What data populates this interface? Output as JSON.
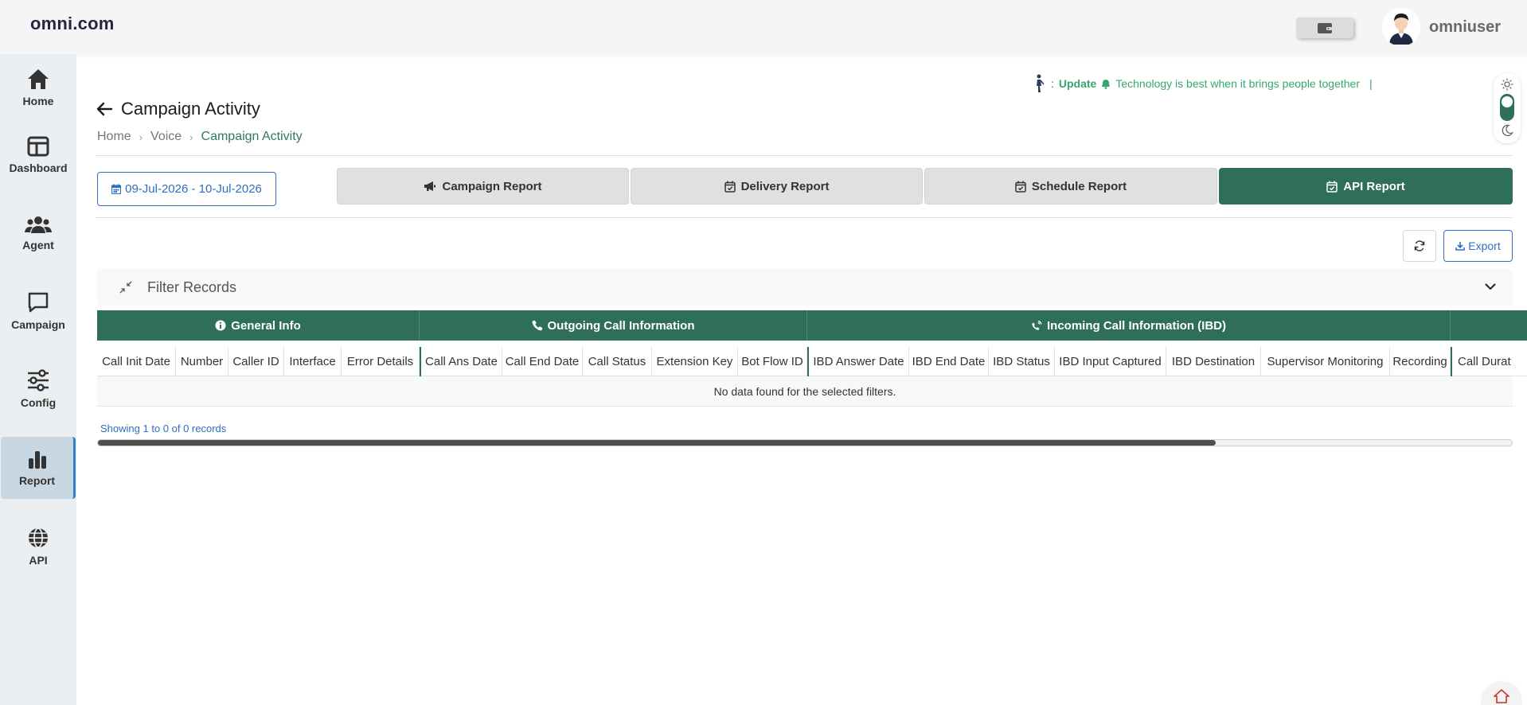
{
  "header": {
    "logo": "omni.com",
    "username": "omniuser"
  },
  "sidebar": {
    "items": [
      {
        "label": "Home",
        "icon": "home-icon"
      },
      {
        "label": "Dashboard",
        "icon": "dashboard-icon"
      },
      {
        "label": "Agent",
        "icon": "agent-icon"
      },
      {
        "label": "Campaign",
        "icon": "campaign-icon"
      },
      {
        "label": "Config",
        "icon": "config-icon"
      },
      {
        "label": "Report",
        "icon": "report-icon",
        "active": true
      },
      {
        "label": "API",
        "icon": "globe-icon"
      }
    ]
  },
  "ticker": {
    "prefix": ":",
    "label": "Update",
    "message": "Technology is best when it brings people together",
    "caret": "|"
  },
  "page": {
    "title": "Campaign Activity",
    "breadcrumb": [
      "Home",
      "Voice",
      "Campaign Activity"
    ]
  },
  "toolbar": {
    "date_range": "09-Jul-2026 - 10-Jul-2026",
    "tabs": [
      {
        "label": "Campaign Report",
        "icon": "megaphone-icon"
      },
      {
        "label": "Delivery Report",
        "icon": "calendar-check-icon"
      },
      {
        "label": "Schedule Report",
        "icon": "calendar-check-icon"
      },
      {
        "label": "API Report",
        "icon": "calendar-check-icon",
        "active": true
      }
    ],
    "export_label": "Export"
  },
  "filter": {
    "label": "Filter Records"
  },
  "table": {
    "groups": [
      "General Info",
      "Outgoing Call Information",
      "Incoming Call Information (IBD)",
      ""
    ],
    "columns": [
      "Call Init Date",
      "Number",
      "Caller ID",
      "Interface",
      "Error Details",
      "Call Ans Date",
      "Call End Date",
      "Call Status",
      "Extension Key",
      "Bot Flow ID",
      "IBD Answer Date",
      "IBD End Date",
      "IBD Status",
      "IBD Input Captured",
      "IBD Destination",
      "Supervisor Monitoring",
      "Recording",
      "Call Durat"
    ],
    "empty_message": "No data found for the selected filters.",
    "showing": "Showing 1 to 0 of 0 records"
  },
  "colors": {
    "primary_green": "#2f6f57",
    "link_blue": "#2d6fc0",
    "ticker_green": "#35a86c"
  }
}
